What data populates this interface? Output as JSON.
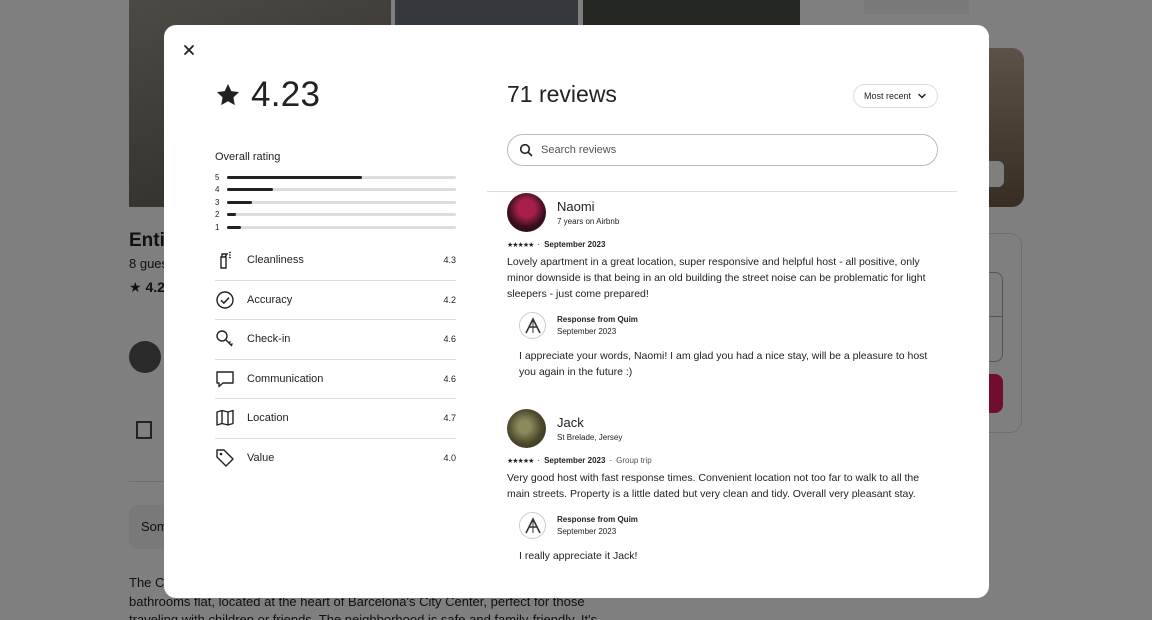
{
  "background": {
    "listing_title": "Enti",
    "guests": "8 gues",
    "rating": "4.2",
    "some": "Som",
    "desc_line1": "The C",
    "desc_line2": "bathrooms flat, located at the heart of Barcelona's City Center, perfect for those",
    "desc_line3": "traveling with children or friends. The neighborhood is safe and family-friendly. It's"
  },
  "modal": {
    "overall_score": "4.23",
    "overall_label": "Overall rating",
    "distribution": [
      {
        "stars": "5",
        "fraction": 0.59
      },
      {
        "stars": "4",
        "fraction": 0.2
      },
      {
        "stars": "3",
        "fraction": 0.11
      },
      {
        "stars": "2",
        "fraction": 0.04
      },
      {
        "stars": "1",
        "fraction": 0.06
      }
    ],
    "categories": [
      {
        "name": "Cleanliness",
        "value": "4.3",
        "icon": "spray-bottle-icon"
      },
      {
        "name": "Accuracy",
        "value": "4.2",
        "icon": "check-circle-icon"
      },
      {
        "name": "Check-in",
        "value": "4.6",
        "icon": "key-icon"
      },
      {
        "name": "Communication",
        "value": "4.6",
        "icon": "chat-bubble-icon"
      },
      {
        "name": "Location",
        "value": "4.7",
        "icon": "map-icon"
      },
      {
        "name": "Value",
        "value": "4.0",
        "icon": "tag-icon"
      }
    ],
    "reviews_title": "71 reviews",
    "sort_label": "Most recent",
    "search_placeholder": "Search reviews",
    "reviews": [
      {
        "name": "Naomi",
        "subtitle": "7 years on Airbnb",
        "stars": "★★★★★",
        "date": "September 2023",
        "trip": "",
        "text": "Lovely apartment in a great location, super responsive and helpful host - all positive, only minor downside is that being in an old building the street noise can be problematic for light sleepers - just come prepared!",
        "response_title": "Response from Quim",
        "response_date": "September 2023",
        "response_text": "I appreciate your words, Naomi! I am glad you had a nice stay, will be a pleasure to host you again in the future :)"
      },
      {
        "name": "Jack",
        "subtitle": "St Brelade, Jersey",
        "stars": "★★★★★",
        "date": "September 2023",
        "trip": "Group trip",
        "text": "Very good host with fast response times. Convenient location not too far to walk to all the main streets. Property is a little dated but very clean and tidy. Overall very pleasant stay.",
        "response_title": "Response from Quim",
        "response_date": "September 2023",
        "response_text": "I really appreciate it Jack!"
      }
    ]
  }
}
